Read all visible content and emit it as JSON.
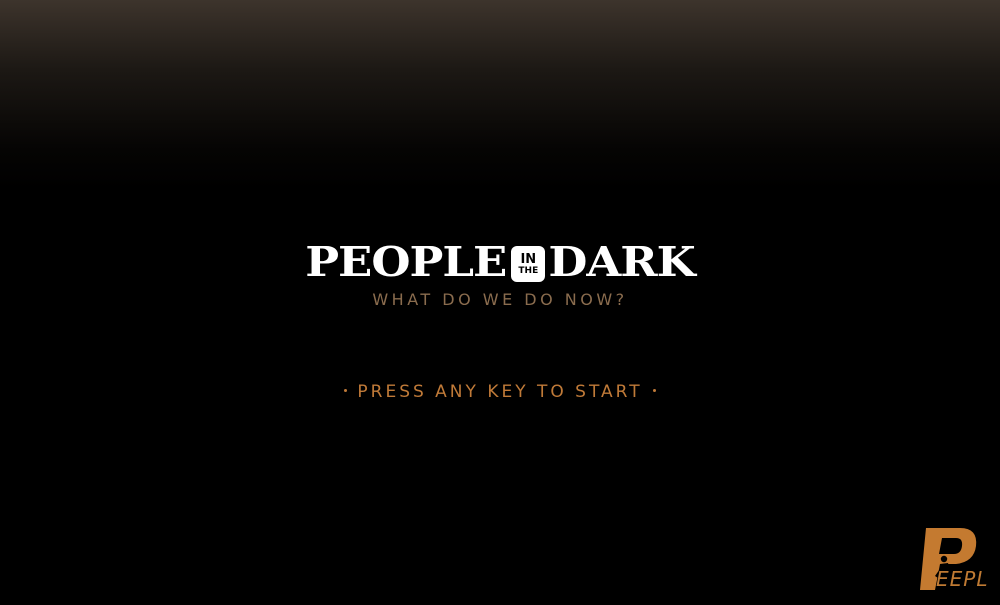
{
  "game": {
    "title_left": "PEOPLE",
    "title_badge_top": "IN",
    "title_badge_bottom": "THE",
    "title_right": "DARK",
    "subtitle": "What Do We Do Now?",
    "start_prompt": "Press any key to start",
    "studio_logo_text": "EEPL"
  },
  "colors": {
    "accent": "#c07a38",
    "subtitle": "#8a6c4e",
    "title": "#ffffff",
    "background": "#000000"
  }
}
